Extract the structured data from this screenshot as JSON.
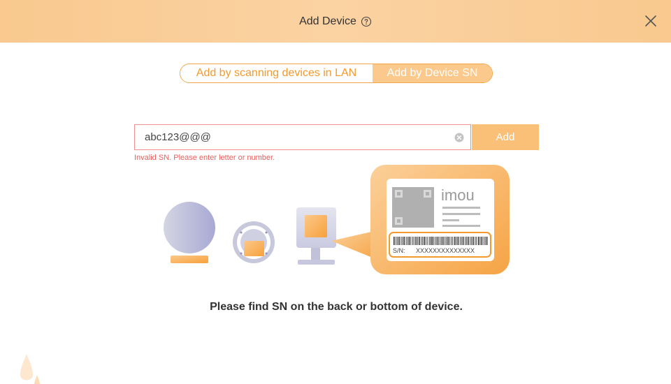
{
  "header": {
    "title": "Add Device"
  },
  "tabs": [
    {
      "label": "Add by scanning devices in LAN",
      "active": false
    },
    {
      "label": "Add by Device SN",
      "active": true
    }
  ],
  "sn_form": {
    "value": "abc123@@@",
    "add_label": "Add",
    "error": "Invalid SN. Please enter letter or number."
  },
  "illustration": {
    "brand": "imou",
    "sn_label": "S/N:",
    "sn_value": "XXXXXXXXXXXXXX"
  },
  "hint": "Please find SN on the back or bottom of device.",
  "colors": {
    "accent": "#f39a2f",
    "header_bg": "#fbd2a2",
    "error": "#e8605e",
    "add_button": "#fbc078"
  }
}
